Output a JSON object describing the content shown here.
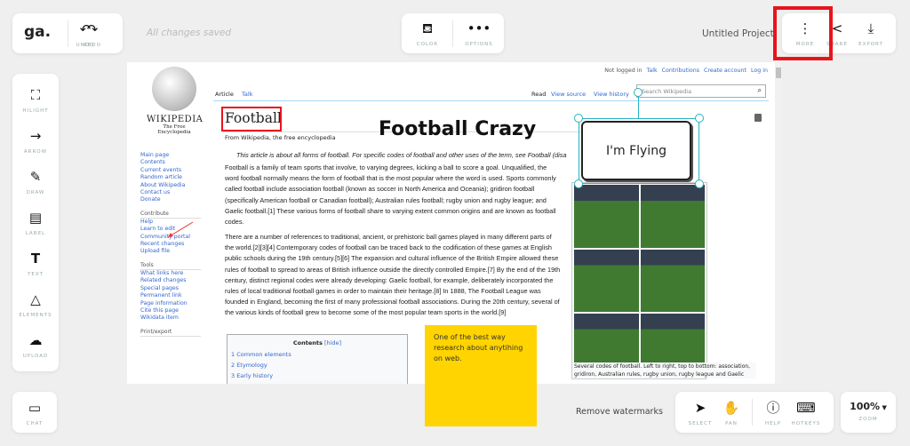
{
  "topbar": {
    "logo": "ga.",
    "undo": "UNDO",
    "redo": "REDO",
    "status": "All changes saved",
    "color": "COLOR",
    "options": "OPTIONS",
    "project": "Untitled Project",
    "more": "MORE",
    "share": "SHARE",
    "export": "EXPORT"
  },
  "tools": [
    "HILIGHT",
    "ARROW",
    "DRAW",
    "LABEL",
    "TEXT",
    "ELEMENTS",
    "UPLOAD"
  ],
  "chat": "CHAT",
  "bottombar": {
    "watermark": "Remove watermarks",
    "select": "SELECT",
    "pan": "PAN",
    "help": "HELP",
    "hotkeys": "HOTKEYS",
    "zoom_value": "100%",
    "zoom": "ZOOM"
  },
  "highlight_color": "#e8141c",
  "wiki": {
    "logo_name": "Wikipedia",
    "logo_tagline": "The Free Encyclopedia",
    "user_links": [
      "Not logged in",
      "Talk",
      "Contributions",
      "Create account",
      "Log in"
    ],
    "tabs_left": [
      "Article",
      "Talk"
    ],
    "tabs_right": [
      "Read",
      "View source",
      "View history"
    ],
    "search_placeholder": "Search Wikipedia",
    "title": "Football",
    "subtitle": "From Wikipedia, the free encyclopedia",
    "hatnote": "This article is about all forms of football. For specific codes of football and other uses of the term, see Football (disa",
    "nav": [
      "Main page",
      "Contents",
      "Current events",
      "Random article",
      "About Wikipedia",
      "Contact us",
      "Donate"
    ],
    "contribute_heading": "Contribute",
    "contribute": [
      "Help",
      "Learn to edit",
      "Community portal",
      "Recent changes",
      "Upload file"
    ],
    "tools_heading": "Tools",
    "tools": [
      "What links here",
      "Related changes",
      "Special pages",
      "Permanent link",
      "Page information",
      "Cite this page",
      "Wikidata item"
    ],
    "print_heading": "Print/export",
    "para1": "Football is a family of team sports that involve, to varying degrees, kicking a ball to score a goal. Unqualified, the word football normally means the form of football that is the most popular where the word is used. Sports commonly called football include association football (known as soccer in North America and Oceania); gridiron football (specifically American football or Canadian football); Australian rules football; rugby union and rugby league; and Gaelic football.[1] These various forms of football share to varying extent common origins and are known as football codes.",
    "para2": "There are a number of references to traditional, ancient, or prehistoric ball games played in many different parts of the world.[2][3][4] Contemporary codes of football can be traced back to the codification of these games at English public schools during the 19th century.[5][6] The expansion and cultural influence of the British Empire allowed these rules of football to spread to areas of British influence outside the directly controlled Empire.[7] By the end of the 19th century, distinct regional codes were already developing: Gaelic football, for example, deliberately incorporated the rules of local traditional football games in order to maintain their heritage.[8] In 1888, The Football League was founded in England, becoming the first of many professional football associations. During the 20th century, several of the various kinds of football grew to become some of the most popular team sports in the world.[9]",
    "contents_title": "Contents",
    "contents_hide": "[hide]",
    "contents": [
      "1  Common elements",
      "2  Etymology",
      "3  Early history"
    ],
    "caption": "Several codes of football. Left to right, top to bottom: association, gridiron, Australian rules, rugby union, rugby league and Gaelic"
  },
  "annotations": {
    "big_text": "Football Crazy",
    "callout": "I'm Flying",
    "sticky": "One of the best way research about anytihing on web.",
    "sticky_color": "#ffd400"
  }
}
